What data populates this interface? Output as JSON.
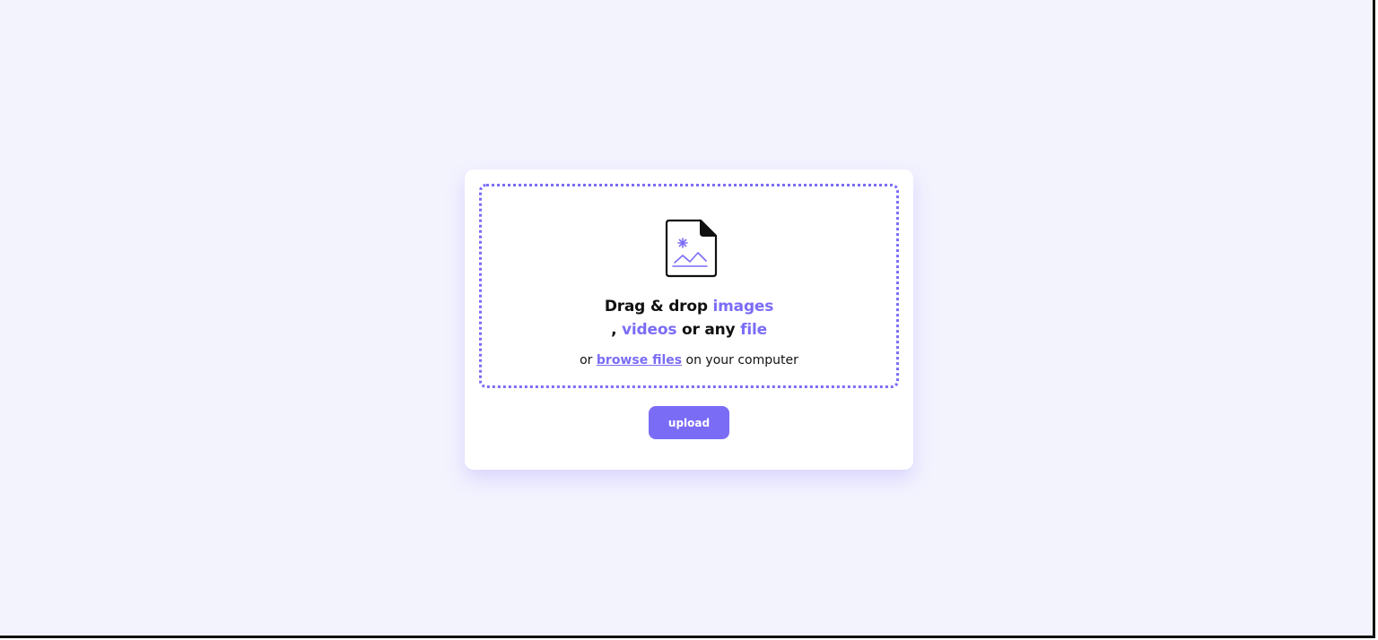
{
  "colors": {
    "page_background": "#f3f3fe",
    "card_background": "#ffffff",
    "accent": "#7b6cf6",
    "text": "#111111",
    "button_text": "#ffffff",
    "frame_border": "#111111"
  },
  "dropzone": {
    "icon": "image-file-icon",
    "headline": {
      "part1": "Drag & drop ",
      "images": "images",
      "part2": ", ",
      "videos": "videos",
      "part3": " or any ",
      "file": "file"
    },
    "subtext": {
      "prefix": "or ",
      "link": "browse files",
      "suffix": " on your computer"
    }
  },
  "upload_button": {
    "label": "upload"
  }
}
